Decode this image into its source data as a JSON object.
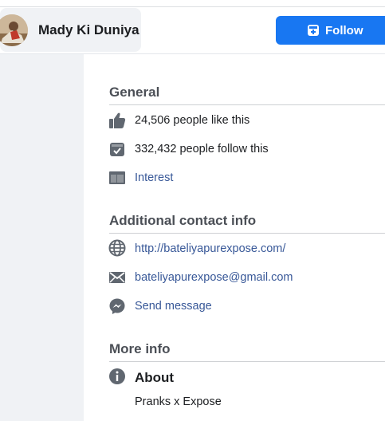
{
  "header": {
    "page_name": "Mady Ki Duniya",
    "follow_label": "Follow",
    "avatar_icon": "profile-photo",
    "follow_icon": "follow-icon",
    "accent_color": "#1877f2"
  },
  "general": {
    "title": "General",
    "likes_text": "24,506 people like this",
    "follows_text": "332,432 people follow this",
    "category": "Interest"
  },
  "contact": {
    "title": "Additional contact info",
    "website": "http://bateliyapurexpose.com/",
    "email": "bateliyapurexpose@gmail.com",
    "message": "Send message"
  },
  "more_info": {
    "title": "More info",
    "about_title": "About",
    "about_text": "Pranks x Expose"
  },
  "icons": {
    "likes": "thumbs-up-icon",
    "follows": "follow-check-icon",
    "category": "category-folder-icon",
    "website": "globe-icon",
    "email": "envelope-icon",
    "message": "messenger-icon",
    "about": "info-icon"
  },
  "colors": {
    "link": "#385898",
    "panel_bg": "#f0f2f5",
    "icon": "#606770"
  }
}
